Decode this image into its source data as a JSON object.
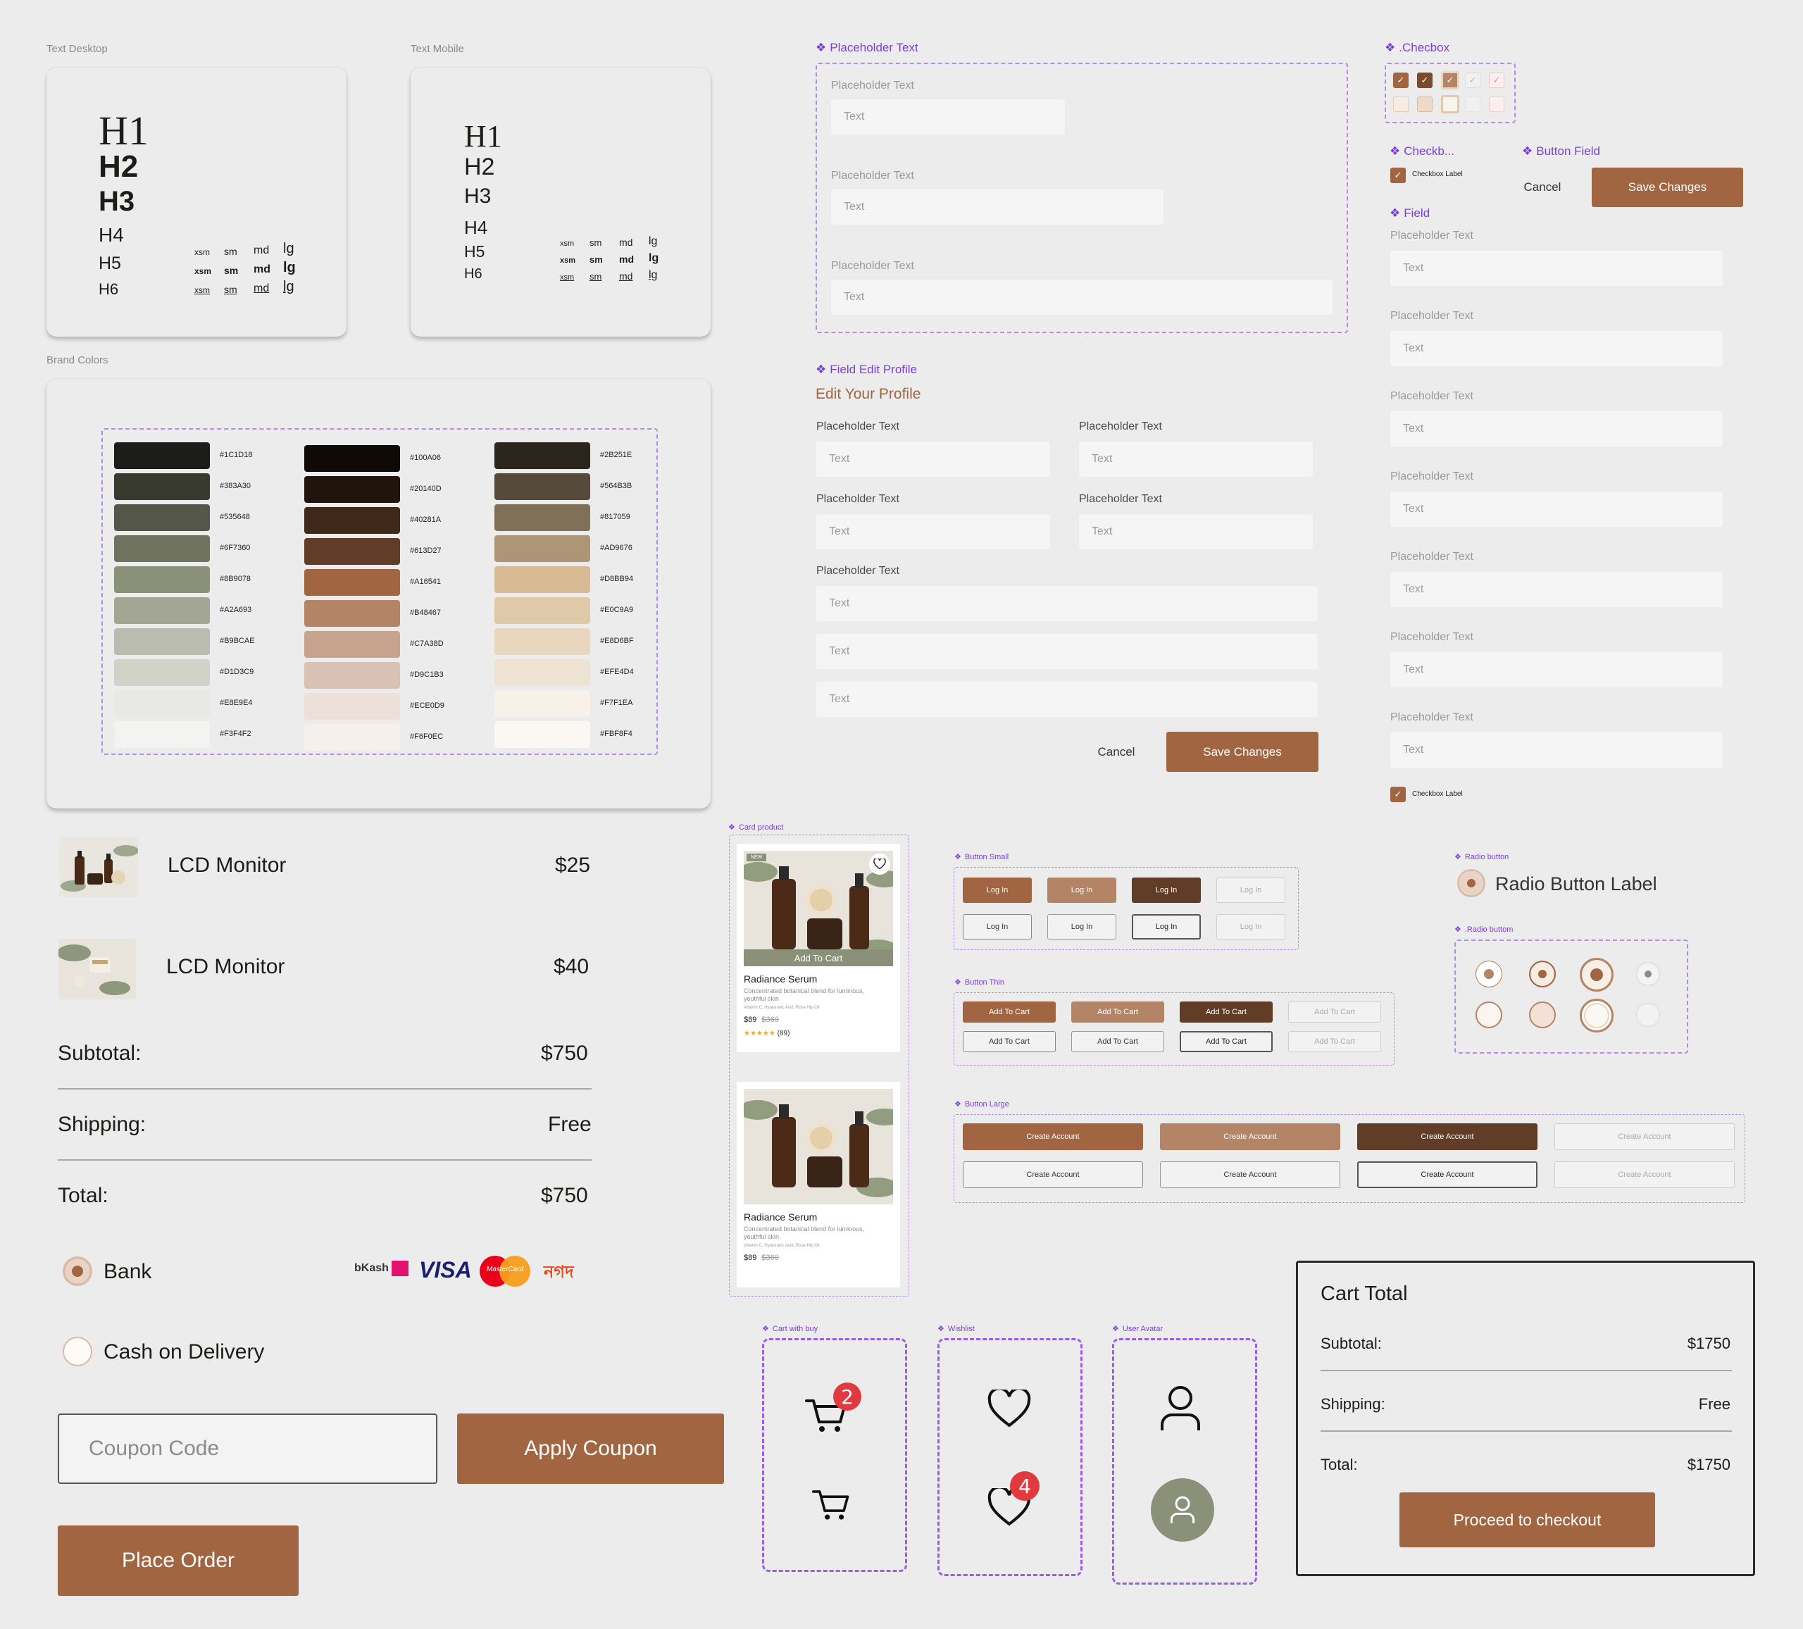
{
  "typography": {
    "desktop_label": "Text Desktop",
    "mobile_label": "Text Mobile",
    "headings": [
      "H1",
      "H2",
      "H3",
      "H4",
      "H5",
      "H6"
    ],
    "sizes": [
      "xsm",
      "sm",
      "md",
      "lg"
    ]
  },
  "brand_colors": {
    "label": "Brand Colors",
    "columns": [
      [
        "#1C1D18",
        "#383A30",
        "#535648",
        "#6F7360",
        "#8B9078",
        "#A2A693",
        "#B9BCAE",
        "#D1D3C9",
        "#E8E9E4",
        "#F3F4F2"
      ],
      [
        "#100A06",
        "#20140D",
        "#40281A",
        "#613D27",
        "#A16541",
        "#B48467",
        "#C7A38D",
        "#D9C1B3",
        "#ECE0D9",
        "#F6F0EC"
      ],
      [
        "#2B251E",
        "#564B3B",
        "#817059",
        "#AD9676",
        "#D8BB94",
        "#E0C9A9",
        "#E8D6BF",
        "#EFE4D4",
        "#F7F1EA",
        "#FBF8F4"
      ]
    ]
  },
  "placeholder_text": {
    "label": "Placeholder Text",
    "items": [
      {
        "label": "Placeholder Text",
        "value": "Text"
      },
      {
        "label": "Placeholder Text",
        "value": "Text"
      },
      {
        "label": "Placeholder Text",
        "value": "Text"
      }
    ]
  },
  "checkbox": {
    "label": ".Checbox",
    "label2": "Checkb...",
    "item_label": "Checkbox Label"
  },
  "button_field": {
    "label": "Button Field",
    "cancel": "Cancel",
    "save": "Save Changes"
  },
  "field": {
    "label": "Field",
    "items": [
      {
        "label": "Placeholder Text",
        "value": "Text"
      },
      {
        "label": "Placeholder Text",
        "value": "Text"
      },
      {
        "label": "Placeholder Text",
        "value": "Text"
      },
      {
        "label": "Placeholder Text",
        "value": "Text"
      },
      {
        "label": "Placeholder Text",
        "value": "Text"
      },
      {
        "label": "Placeholder Text",
        "value": "Text"
      },
      {
        "label": "Placeholder Text",
        "value": "Text"
      }
    ],
    "checkbox_label": "Checkbox Label"
  },
  "edit_profile": {
    "label": "Field Edit Profile",
    "title": "Edit Your Profile",
    "field_label": "Placeholder Text",
    "field_value": "Text",
    "cancel": "Cancel",
    "save": "Save Changes"
  },
  "order": {
    "items": [
      {
        "name": "LCD Monitor",
        "price": "$25"
      },
      {
        "name": "LCD Monitor",
        "price": "$40"
      }
    ],
    "subtotal_label": "Subtotal:",
    "subtotal": "$750",
    "shipping_label": "Shipping:",
    "shipping": "Free",
    "total_label": "Total:",
    "total": "$750",
    "payment": [
      {
        "label": "Bank",
        "selected": true
      },
      {
        "label": "Cash on Delivery",
        "selected": false
      }
    ],
    "payment_logos": [
      "bKash",
      "VISA",
      "MasterCard",
      "নগদ"
    ],
    "coupon_placeholder": "Coupon Code",
    "apply_coupon": "Apply Coupon",
    "place_order": "Place Order"
  },
  "card_product": {
    "label": "Card product",
    "badge": "NEW",
    "add_to_cart": "Add To Cart",
    "title": "Radiance Serum",
    "desc": "Concentrated botanical blend for luminous, youthful skin",
    "ingredients": "Vitamin C, Hyaluronic Acid, Rose Hip Oil",
    "price": "$89",
    "old_price": "$360",
    "rating": 5,
    "reviews": "(89)",
    "brand": "ARUN"
  },
  "buttons": {
    "small_label": "Button Small",
    "small_text": "Log In",
    "thin_label": "Button Thin",
    "thin_text": "Add To Cart",
    "large_label": "Button Large",
    "large_text": "Create Account"
  },
  "radio": {
    "label": "Radio button",
    "item_label": "Radio Button Label",
    "set_label": ".Radio buttom"
  },
  "icons": {
    "cart_label": "Cart with buy",
    "cart_count": "2",
    "wishlist_label": "Wishlist",
    "wishlist_count": "4",
    "avatar_label": "User Avatar"
  },
  "cart_total": {
    "title": "Cart Total",
    "subtotal_label": "Subtotal:",
    "subtotal": "$1750",
    "shipping_label": "Shipping:",
    "shipping": "Free",
    "total_label": "Total:",
    "total": "$1750",
    "checkout": "Proceed to checkout"
  },
  "colors": {
    "brand": "#A16541",
    "dark": "#613D27",
    "sage": "#8B9078",
    "purple": "#9B5CE6"
  }
}
